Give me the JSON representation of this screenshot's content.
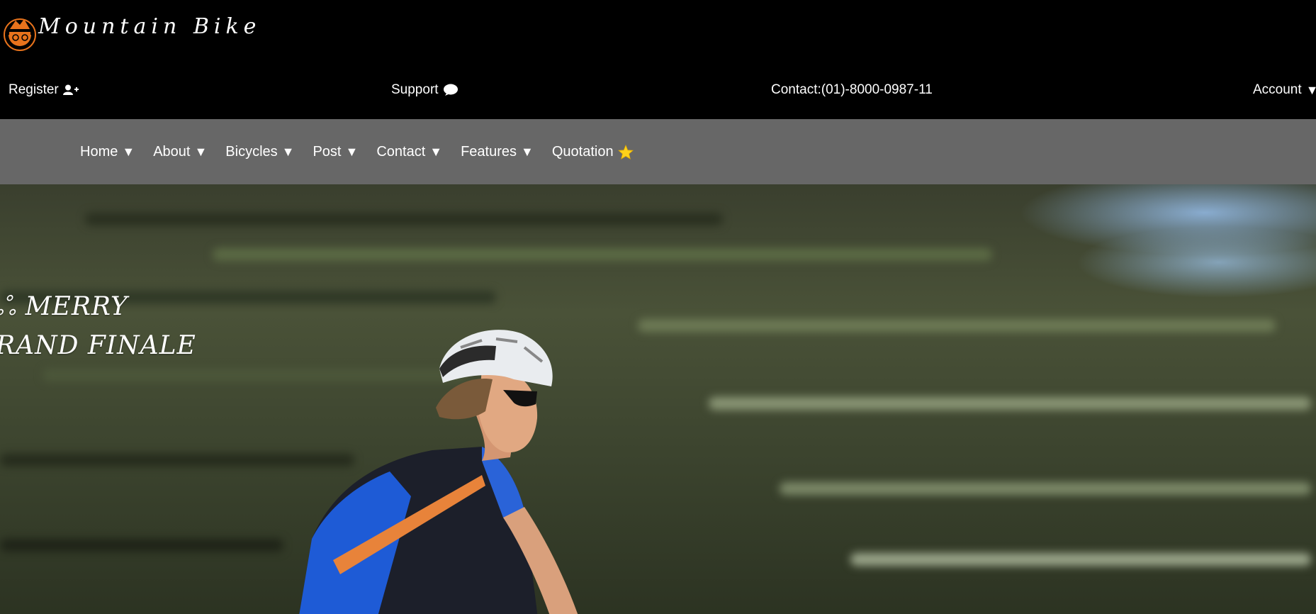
{
  "brand": {
    "name": "Mountain Bike",
    "logo_icon": "bike-badge-icon"
  },
  "utility_bar": {
    "register": {
      "label": "Register",
      "icon": "user-plus-icon"
    },
    "support": {
      "label": "Support",
      "icon": "chat-bubble-icon"
    },
    "contact": {
      "label": "Contact:(01)-8000-0987-11"
    },
    "account": {
      "label": "Account",
      "caret": "▼"
    }
  },
  "nav": {
    "items": [
      {
        "label": "Home",
        "caret": "▼"
      },
      {
        "label": "About",
        "caret": "▼"
      },
      {
        "label": "Bicycles",
        "caret": "▼"
      },
      {
        "label": "Post",
        "caret": "▼"
      },
      {
        "label": "Contact",
        "caret": "▼"
      },
      {
        "label": "Features",
        "caret": "▼"
      },
      {
        "label": "Quotation",
        "icon": "star-icon"
      }
    ]
  },
  "hero": {
    "line_1": "ஃ MERRY",
    "line_2": "RAND FINALE"
  },
  "colors": {
    "top_bar": "#000000",
    "nav_bar": "#676767",
    "logo_orange": "#e8731c",
    "star": "#ffd21a",
    "text": "#ffffff"
  }
}
